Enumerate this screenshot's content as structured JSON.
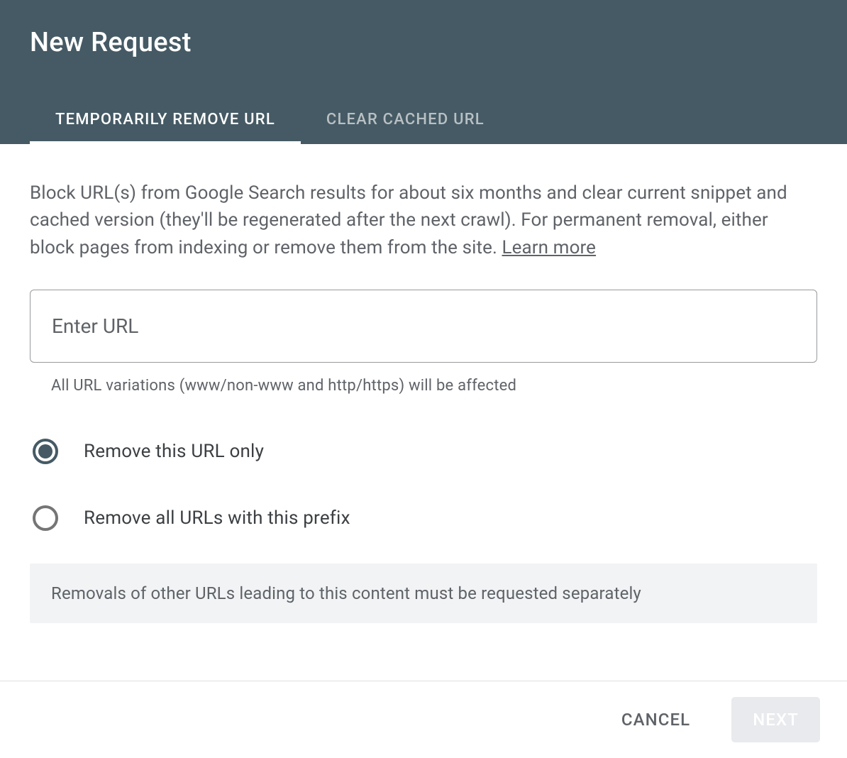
{
  "dialog": {
    "title": "New Request",
    "tabs": [
      {
        "label": "TEMPORARILY REMOVE URL",
        "active": true
      },
      {
        "label": "CLEAR CACHED URL",
        "active": false
      }
    ],
    "description_text": "Block URL(s) from Google Search results for about six months and clear current snippet and cached version (they'll be regenerated after the next crawl). For permanent removal, either block pages from indexing or remove them from the site. ",
    "learn_more_label": "Learn more",
    "url_input": {
      "placeholder": "Enter URL",
      "value": "",
      "helper": "All URL variations (www/non-www and http/https) will be affected"
    },
    "radio_options": [
      {
        "label": "Remove this URL only",
        "selected": true
      },
      {
        "label": "Remove all URLs with this prefix",
        "selected": false
      }
    ],
    "notice": "Removals of other URLs leading to this content must be requested separately",
    "footer": {
      "cancel_label": "CANCEL",
      "next_label": "NEXT"
    }
  }
}
